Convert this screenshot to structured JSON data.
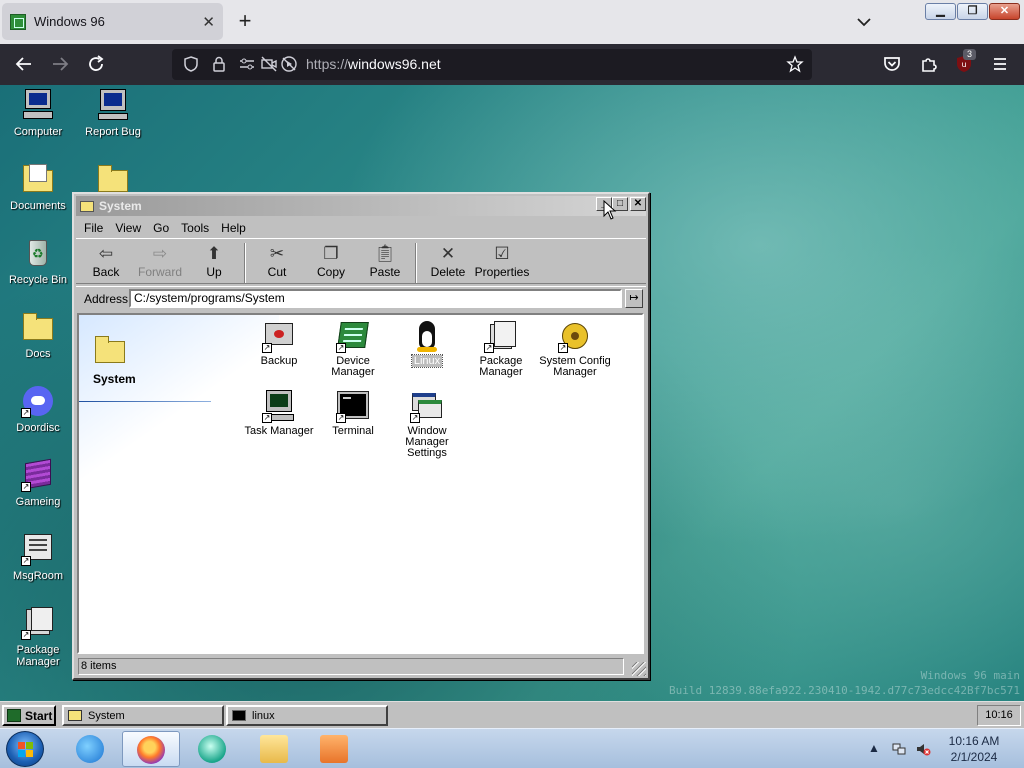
{
  "browser": {
    "tab_title": "Windows 96",
    "url_scheme": "https://",
    "url_host": "windows96.net",
    "extension_badge": "3"
  },
  "desktop": {
    "icons": [
      {
        "label": "Computer"
      },
      {
        "label": "Report Bug"
      },
      {
        "label": "Documents"
      },
      {
        "label": "Recycle Bin"
      },
      {
        "label": "Docs"
      },
      {
        "label": "Doordisc"
      },
      {
        "label": "Gameing"
      },
      {
        "label": "MsgRoom"
      },
      {
        "label": "Package Manager"
      }
    ],
    "watermark": {
      "line1": "Windows 96 main",
      "line2": "Build 12839.88efa922.230410-1942.d77c73edcc42Bf7bc571"
    }
  },
  "explorer": {
    "title": "System",
    "menu": [
      "File",
      "View",
      "Go",
      "Tools",
      "Help"
    ],
    "toolbar": {
      "back": "Back",
      "forward": "Forward",
      "up": "Up",
      "cut": "Cut",
      "copy": "Copy",
      "paste": "Paste",
      "delete": "Delete",
      "properties": "Properties"
    },
    "address_label": "Address",
    "address_value": "C:/system/programs/System",
    "sidebar_title": "System",
    "items": [
      {
        "label": "Backup"
      },
      {
        "label": "Device Manager"
      },
      {
        "label": "Linux"
      },
      {
        "label": "Package Manager"
      },
      {
        "label": "System Config Manager"
      },
      {
        "label": "Task Manager"
      },
      {
        "label": "Terminal"
      },
      {
        "label": "Window Manager Settings"
      }
    ],
    "selected_item": "Linux",
    "status": "8 items"
  },
  "w96_taskbar": {
    "start_label": "Start",
    "tasks": [
      "System",
      "linux"
    ],
    "clock": "10:16"
  },
  "host_taskbar": {
    "time": "10:16 AM",
    "date": "2/1/2024"
  }
}
